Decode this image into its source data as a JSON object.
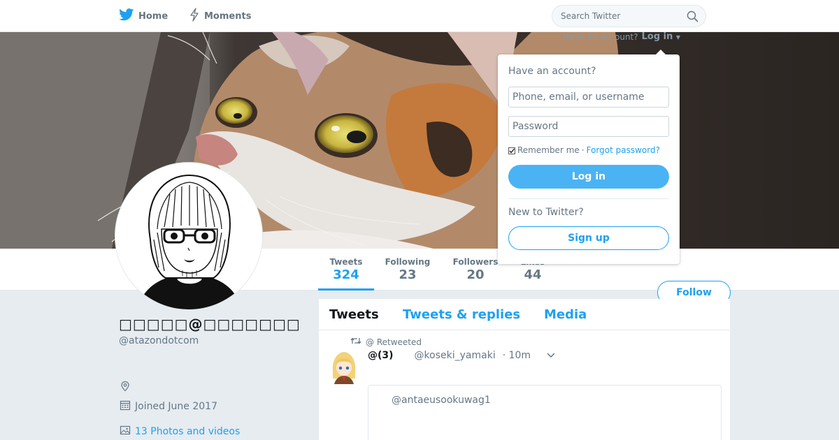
{
  "nav": {
    "home_label": "Home",
    "moments_label": "Moments",
    "search_placeholder": "Search Twitter"
  },
  "account": {
    "have_account_text": "Have an account?",
    "login_label": "Log in"
  },
  "login_dropdown": {
    "heading": "Have an account?",
    "username_placeholder": "Phone, email, or username",
    "password_placeholder": "Password",
    "remember_label": "Remember me",
    "separator": "·",
    "forgot_label": "Forgot password?",
    "login_button": "Log in",
    "new_heading": "New to Twitter?",
    "signup_button": "Sign up"
  },
  "profile_nav": {
    "stats": [
      {
        "label": "Tweets",
        "value": "324"
      },
      {
        "label": "Following",
        "value": "23"
      },
      {
        "label": "Followers",
        "value": "20"
      },
      {
        "label": "Likes",
        "value": "44"
      }
    ],
    "follow_label": "Follow"
  },
  "profile": {
    "display_name": "□□□□□@□□□□□□□",
    "handle": "@atazondotcom",
    "joined": "Joined June 2017",
    "photos_link": "13 Photos and videos"
  },
  "timeline": {
    "tabs": [
      "Tweets",
      "Tweets & replies",
      "Media"
    ],
    "tweet": {
      "retweet_context": "@ Retweeted",
      "name": "@(3)",
      "handle": "@koseki_yamaki",
      "time": "· 10m",
      "quote_handle": "@antaeusookuwag1"
    }
  },
  "colors": {
    "accent": "#1da1f2",
    "button_blue": "#4ab3f4",
    "page_bg": "#e6ecf0"
  },
  "icons": {
    "home": "twitter-bird-icon",
    "moments": "lightning-icon",
    "search": "magnifier-icon",
    "location": "location-pin-icon",
    "joined": "calendar-icon",
    "photos": "image-icon",
    "retweet": "retweet-icon",
    "tweet_menu": "chevron-down-icon"
  }
}
